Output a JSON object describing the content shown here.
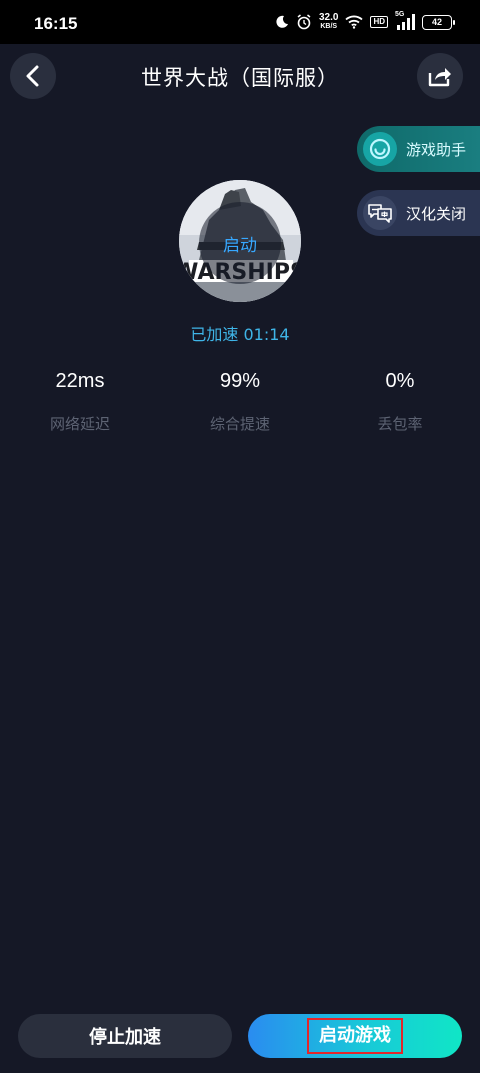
{
  "status_bar": {
    "time": "16:15",
    "net_speed": "32.0",
    "net_unit": "KB/S",
    "hd": "HD",
    "network": "5G",
    "battery": "42"
  },
  "header": {
    "title": "世界大战（国际服）",
    "back_icon": "chevron-left-icon",
    "share_icon": "share-icon"
  },
  "side_buttons": [
    {
      "label": "游戏助手",
      "icon": "assistant-icon"
    },
    {
      "label": "汉化关闭",
      "icon": "translate-icon"
    }
  ],
  "game": {
    "overlay_label": "启动",
    "banner_text": "WARSHIPS"
  },
  "acceleration": {
    "status": "已加速",
    "elapsed": "01:14"
  },
  "stats": [
    {
      "value": "22ms",
      "label": "网络延迟"
    },
    {
      "value": "99%",
      "label": "综合提速"
    },
    {
      "value": "0%",
      "label": "丢包率"
    }
  ],
  "actions": {
    "stop_label": "停止加速",
    "launch_label": "启动游戏"
  },
  "colors": {
    "background": "#151826",
    "accent_cyan": "#3fb5e8",
    "highlight_red": "#e3262a"
  }
}
